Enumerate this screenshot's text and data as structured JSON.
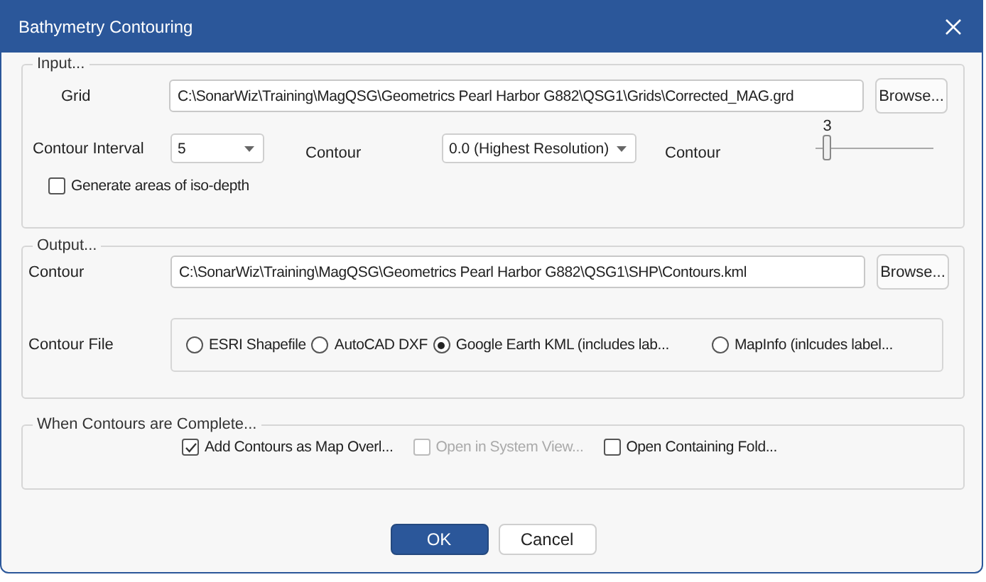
{
  "window": {
    "title": "Bathymetry Contouring"
  },
  "input": {
    "legend": "Input...",
    "grid_label": "Grid",
    "grid_path": "C:\\SonarWiz\\Training\\MagQSG\\Geometrics Pearl Harbor G882\\QSG1\\Grids\\Corrected_MAG.grd",
    "browse": "Browse...",
    "interval_label": "Contour Interval",
    "interval_value": "5",
    "contour_label": "Contour",
    "contour_value": "0.0 (Highest Resolution)",
    "slider": {
      "label": "Contour",
      "reading": "3",
      "level": 0.1
    },
    "iso_depth": {
      "label": "Generate areas of iso-depth",
      "checked": false
    }
  },
  "output": {
    "legend": "Output...",
    "contour_label": "Contour",
    "contour_path": "C:\\SonarWiz\\Training\\MagQSG\\Geometrics Pearl Harbor G882\\QSG1\\SHP\\Contours.kml",
    "browse": "Browse...",
    "file_label": "Contour File",
    "formats": [
      {
        "label": "ESRI Shapefile",
        "selected": false
      },
      {
        "label": "AutoCAD DXF",
        "selected": false
      },
      {
        "label": "Google Earth KML (includes lab...",
        "selected": true
      },
      {
        "label": "MapInfo (inlcudes label...",
        "selected": false
      }
    ]
  },
  "complete": {
    "legend": "When Contours are Complete...",
    "options": [
      {
        "label": "Add Contours as Map Overl...",
        "checked": true,
        "disabled": false
      },
      {
        "label": "Open in System View...",
        "checked": false,
        "disabled": true
      },
      {
        "label": "Open Containing Fold...",
        "checked": false,
        "disabled": false
      }
    ]
  },
  "buttons": [
    {
      "label": "OK",
      "kind": "primary"
    },
    {
      "label": "Cancel",
      "kind": "secondary"
    }
  ]
}
